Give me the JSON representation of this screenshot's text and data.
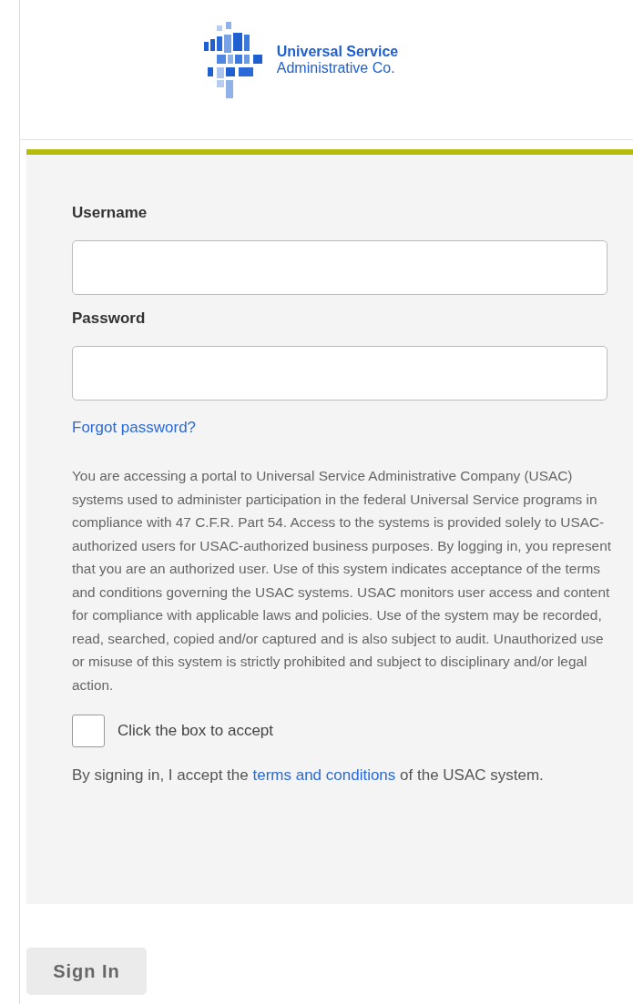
{
  "logo": {
    "line_1": "Universal Service",
    "line_2": "Administrative Co."
  },
  "form": {
    "username": {
      "label": "Username"
    },
    "password": {
      "label": "Password"
    },
    "forgot_link": "Forgot password?",
    "notice": "You are accessing a portal to Universal Service Administrative Company (USAC) systems used to administer participation in the federal Universal Service programs in compliance with 47 C.F.R. Part 54. Access to the systems is provided solely to USAC-authorized users for USAC-authorized business purposes. By logging in, you represent that you are an authorized user. Use of this system indicates acceptance of the terms and conditions governing the USAC systems. USAC monitors user access and content for compliance with applicable laws and policies. Use of the system may be recorded, read, searched, copied and/or captured and is also subject to audit. Unauthorized use or misuse of this system is strictly prohibited and subject to disciplinary and/or legal action.",
    "accept": {
      "label": "Click the box to accept",
      "checked": false
    },
    "terms": {
      "before": "By signing in, I accept the",
      "link": "terms and conditions",
      "after": "of the USAC system."
    }
  },
  "sign_in": {
    "label": "Sign In",
    "disabled": true
  }
}
